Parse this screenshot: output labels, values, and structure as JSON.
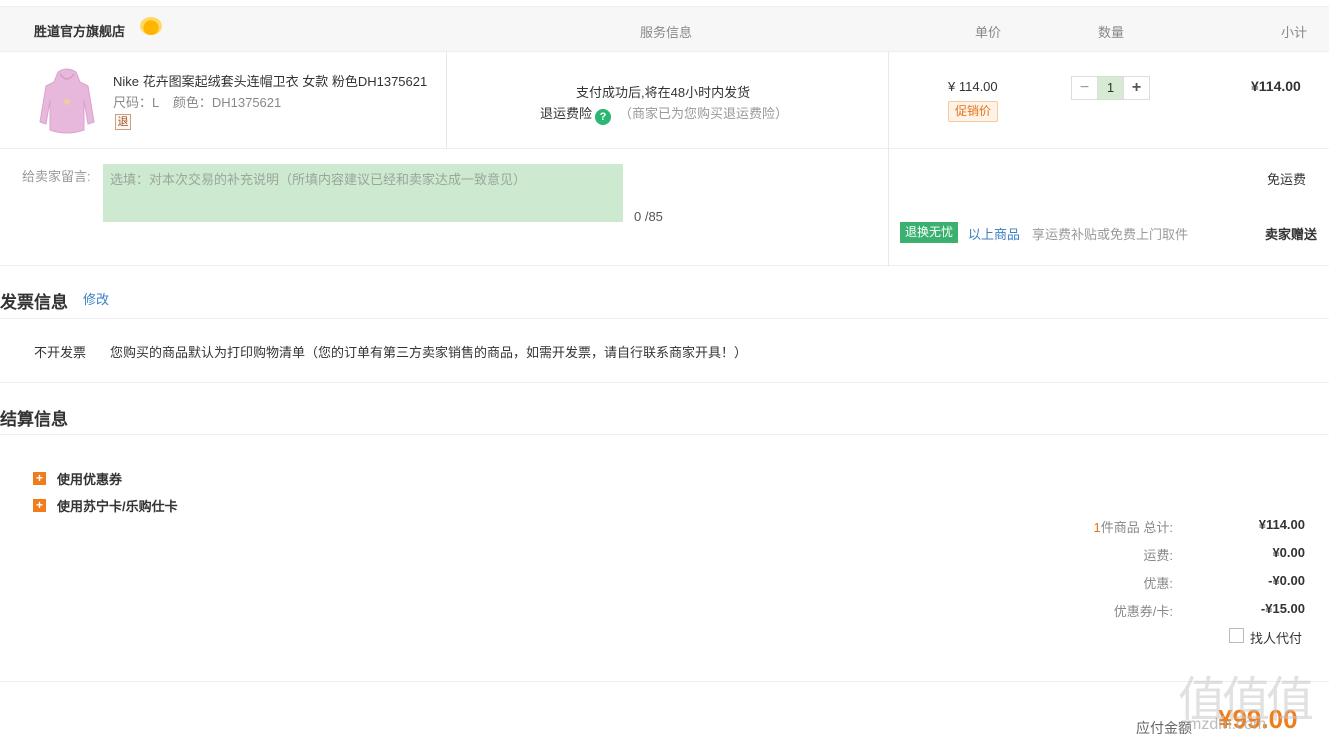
{
  "header": {
    "store_name": "胜道官方旗舰店",
    "col_service": "服务信息",
    "col_price": "单价",
    "col_qty": "数量",
    "col_subtotal": "小计"
  },
  "product": {
    "name": "Nike 花卉图案起绒套头连帽卫衣 女款 粉色DH1375621",
    "size_label": "尺码：L",
    "color_label": "颜色：DH1375621",
    "return_tag": "退",
    "service_line1": "支付成功后,将在48小时内发货",
    "service_insurance": "退运费险",
    "service_note": "（商家已为您购买退运费险）",
    "price": "¥ 114.00",
    "promo_tag": "促销价",
    "qty": "1",
    "qty_minus": "−",
    "qty_plus": "+",
    "subtotal": "¥114.00"
  },
  "message": {
    "label": "给卖家留言:",
    "placeholder": "选填：对本次交易的补充说明（所填内容建议已经和卖家达成一致意见）",
    "counter": "0 /85",
    "shipping": "免运费",
    "return_badge": "退换无忧",
    "goods_link": "以上商品",
    "goods_desc": "享运费补贴或免费上门取件",
    "seller_gift": "卖家赠送"
  },
  "invoice": {
    "title": "发票信息",
    "edit": "修改",
    "type": "不开发票",
    "description": "您购买的商品默认为打印购物清单（您的订单有第三方卖家销售的商品，如需开发票，请自行联系商家开具！）"
  },
  "settlement": {
    "title": "结算信息",
    "options": [
      "使用优惠券",
      "使用苏宁卡/乐购仕卡"
    ],
    "summary": {
      "count": "1",
      "count_suffix": "件商品 总计:",
      "total": "¥114.00",
      "shipping_label": "运费:",
      "shipping": "¥0.00",
      "discount_label": "优惠:",
      "discount": "-¥0.00",
      "coupon_label": "优惠券/卡:",
      "coupon": "-¥15.00",
      "proxy_pay": "找人代付"
    },
    "payable_label": "应付金额",
    "payable": "¥99.00"
  },
  "watermark": {
    "logo": "值值值",
    "site": "smzdm.com"
  }
}
